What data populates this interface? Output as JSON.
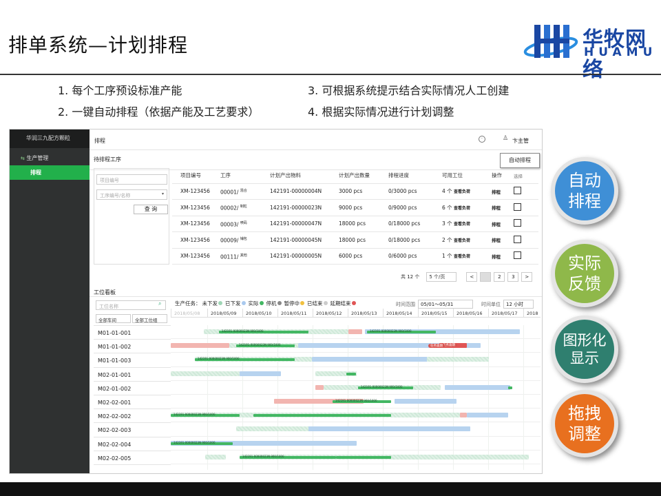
{
  "slide": {
    "title": "排单系统—计划排程",
    "logo": {
      "cn": "华牧网络",
      "en": "HUAMU"
    },
    "points": [
      "1. 每个工序预设标准产能",
      "2. 一键自动排程（依据产能及工艺要求）",
      "3. 可根据系统提示结合实际情况人工创建",
      "4. 根据实际情况进行计划调整"
    ],
    "bubbles": [
      {
        "label": "自动\n排程",
        "color": "#3f8fd6"
      },
      {
        "label": "实际\n反馈",
        "color": "#8fb84a"
      },
      {
        "label": "图形化\n显示",
        "color": "#2f7f6f"
      },
      {
        "label": "拖拽\n调整",
        "color": "#e8701f"
      }
    ]
  },
  "app": {
    "brand": "华润三九配方颗粒",
    "nav": {
      "group": "生产管理",
      "active": "排程"
    },
    "header": {
      "title": "排程",
      "user": "卞主管"
    },
    "pending": {
      "section_title": "待排程工序",
      "auto_button": "自动排程",
      "search_placeholder": "项目编号",
      "process_placeholder": "工序编号/名称",
      "query_button": "查 询",
      "columns": [
        "项目编号",
        "工序",
        "计划产出物料",
        "计划产出数量",
        "排程进度",
        "可用工位",
        "操作",
        "选择"
      ],
      "rows": [
        {
          "project": "XM-123456",
          "proc": "00001/",
          "proc_name": "混合",
          "material": "142191-00000004N",
          "qty": "3000 pcs",
          "progress": "0/3000 pcs",
          "stations": "4 个",
          "view": "查看负荷",
          "op": "排程"
        },
        {
          "project": "XM-123456",
          "proc": "00002/",
          "proc_name": "制粒",
          "material": "142191-00000023N",
          "qty": "9000 pcs",
          "progress": "0/9000 pcs",
          "stations": "6 个",
          "view": "查看负荷",
          "op": "排程"
        },
        {
          "project": "XM-123456",
          "proc": "00003/",
          "proc_name": "喷码",
          "material": "142191-00000047N",
          "qty": "18000 pcs",
          "progress": "0/18000 pcs",
          "stations": "3 个",
          "view": "查看负荷",
          "op": "排程"
        },
        {
          "project": "XM-123456",
          "proc": "00009/",
          "proc_name": "铺包",
          "material": "142191-00000045N",
          "qty": "18000 pcs",
          "progress": "0/18000 pcs",
          "stations": "2 个",
          "view": "查看负荷",
          "op": "排程"
        },
        {
          "project": "XM-123456",
          "proc": "00111/",
          "proc_name": "其他",
          "material": "142191-00000005N",
          "qty": "6000 pcs",
          "progress": "0/6000 pcs",
          "stations": "1 个",
          "view": "查看负荷",
          "op": "排程"
        }
      ],
      "pagination": {
        "total": "共 12 个",
        "per_page": "5 个/页",
        "prev": "<",
        "pages": [
          "1",
          "2",
          "3"
        ],
        "next": ">"
      }
    },
    "board": {
      "section_title": "工位看板",
      "search_placeholder": "工位名称",
      "workshop_filter": "全部车间",
      "group_filter": "全部工位组",
      "legend_title": "生产任务：",
      "legend": [
        {
          "label": "未下发",
          "color": "#9fd6b6"
        },
        {
          "label": "已下发",
          "color": "#a9c9ee"
        },
        {
          "label": "实际",
          "color": "#43b763"
        },
        {
          "label": "停机",
          "color": "#888888"
        },
        {
          "label": "暂停中",
          "color": "#f0c040"
        },
        {
          "label": "已结束",
          "color": "#cccccc"
        },
        {
          "label": "延期结束",
          "color": "#e05555"
        }
      ],
      "range_label": "时间范围",
      "range_value": "05/01～05/31",
      "unit_label": "时间单位",
      "unit_value": "12 小时",
      "dates": [
        "2018/05/08",
        "2018/05/09",
        "2018/05/10",
        "2018/05/11",
        "2018/05/12",
        "2018/05/13",
        "2018/05/14",
        "2018/05/15",
        "2018/05/16",
        "2018/05/17",
        "2018"
      ],
      "stations": [
        "M01-01-001",
        "M01-01-002",
        "M01-01-003",
        "M02-01-001",
        "M02-01-002",
        "M02-02-001",
        "M02-02-002",
        "M02-02-003",
        "M02-02-004",
        "M02-02-005"
      ],
      "bar_text": "142191-00000023N  900/1000",
      "overdue_text": "任务逾期"
    }
  }
}
